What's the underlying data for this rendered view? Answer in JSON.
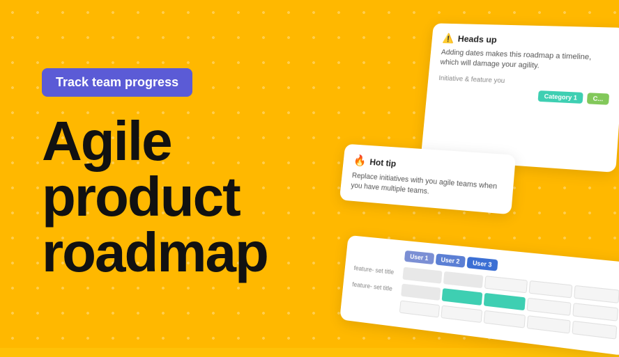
{
  "background": {
    "color": "#FFB800"
  },
  "badge": {
    "label": "Track team progress",
    "bg_color": "#5B5BD6"
  },
  "title": {
    "line1": "Agile",
    "line2": "product",
    "line3": "roadmap"
  },
  "cards": {
    "heads_up": {
      "title": "Heads up",
      "body": "Adding dates makes this roadmap a timeline, which will damage your agility.",
      "initiative_label": "Initiative & feature you",
      "category1": "Category 1",
      "category2": "C..."
    },
    "hot_tip": {
      "title": "Hot tip",
      "body": "Replace initiatives with you agile teams when you have multiple teams."
    },
    "roadmap": {
      "feature_label1": "feature- set title",
      "feature_label2": "feature- set title",
      "users": [
        "User 1",
        "User 2",
        "User 3"
      ]
    }
  }
}
